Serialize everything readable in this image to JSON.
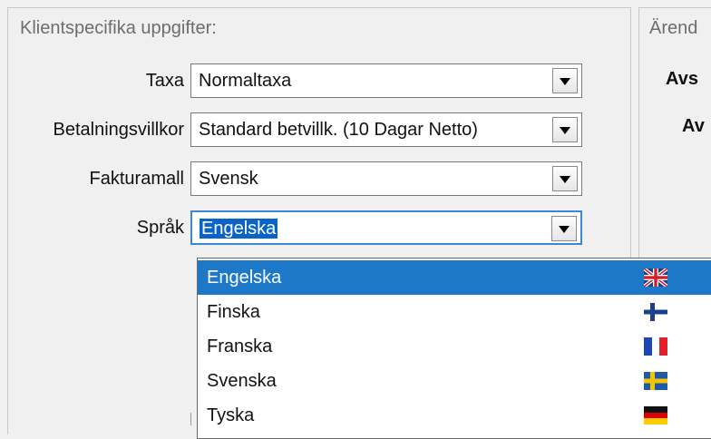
{
  "left_panel": {
    "title": "Klientspecifika uppgifter:",
    "fields": [
      {
        "label": "Taxa",
        "value": "Normaltaxa"
      },
      {
        "label": "Betalningsvillkor",
        "value": "Standard betvillk. (10 Dagar Netto)"
      },
      {
        "label": "Fakturamall",
        "value": "Svensk"
      },
      {
        "label": "Språk",
        "value": "Engelska"
      }
    ]
  },
  "right_panel": {
    "title": "Ärend",
    "labels": [
      "Avs",
      "Av"
    ]
  },
  "dropdown": {
    "selected_index": 0,
    "items": [
      {
        "name": "Engelska",
        "flag": "uk-flag-icon"
      },
      {
        "name": "Finska",
        "flag": "finland-flag-icon"
      },
      {
        "name": "Franska",
        "flag": "france-flag-icon"
      },
      {
        "name": "Svenska",
        "flag": "sweden-flag-icon"
      },
      {
        "name": "Tyska",
        "flag": "germany-flag-icon"
      }
    ]
  },
  "colors": {
    "selection": "#1e78c8",
    "focus_border": "#3a88d0",
    "background": "#f0f0f0"
  }
}
